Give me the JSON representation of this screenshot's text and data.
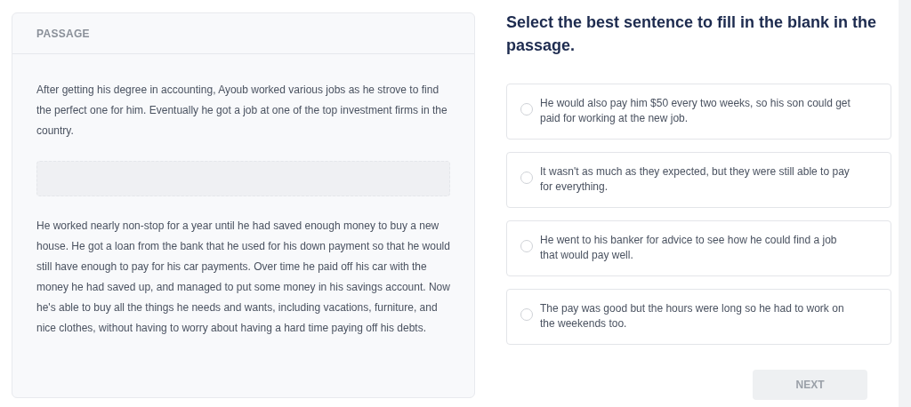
{
  "passage": {
    "heading": "PASSAGE",
    "paragraphs_before": [
      "After getting his degree in accounting, Ayoub worked various jobs as he strove to find the perfect one for him. Eventually he got a job at one of the top investment firms in the country."
    ],
    "paragraphs_after": [
      "He worked nearly non-stop for a year until he had saved enough money to buy a new house. He got a loan from the bank that he used for his down payment so that he would still have enough to pay for his car payments. Over time he paid off his car with the money he had saved up, and managed to put some money in his savings account. Now he's able to buy all the things he needs and wants, including vacations, furniture, and nice clothes, without having to worry about having a hard time paying off his debts."
    ]
  },
  "question": "Select the best sentence to fill in the blank in the passage.",
  "options": [
    {
      "text": "He would also pay him $50 every two weeks, so his son could get paid for working at the new job.",
      "selected": false
    },
    {
      "text": "It wasn't as much as they expected, but they were still able to pay for everything.",
      "selected": false
    },
    {
      "text": "He went to his banker for advice to see how he could find a job that would pay well.",
      "selected": false
    },
    {
      "text": "The pay was good but the hours were long so he had to work on the weekends too.",
      "selected": false
    }
  ],
  "next_button": {
    "label": "NEXT",
    "disabled": true
  }
}
